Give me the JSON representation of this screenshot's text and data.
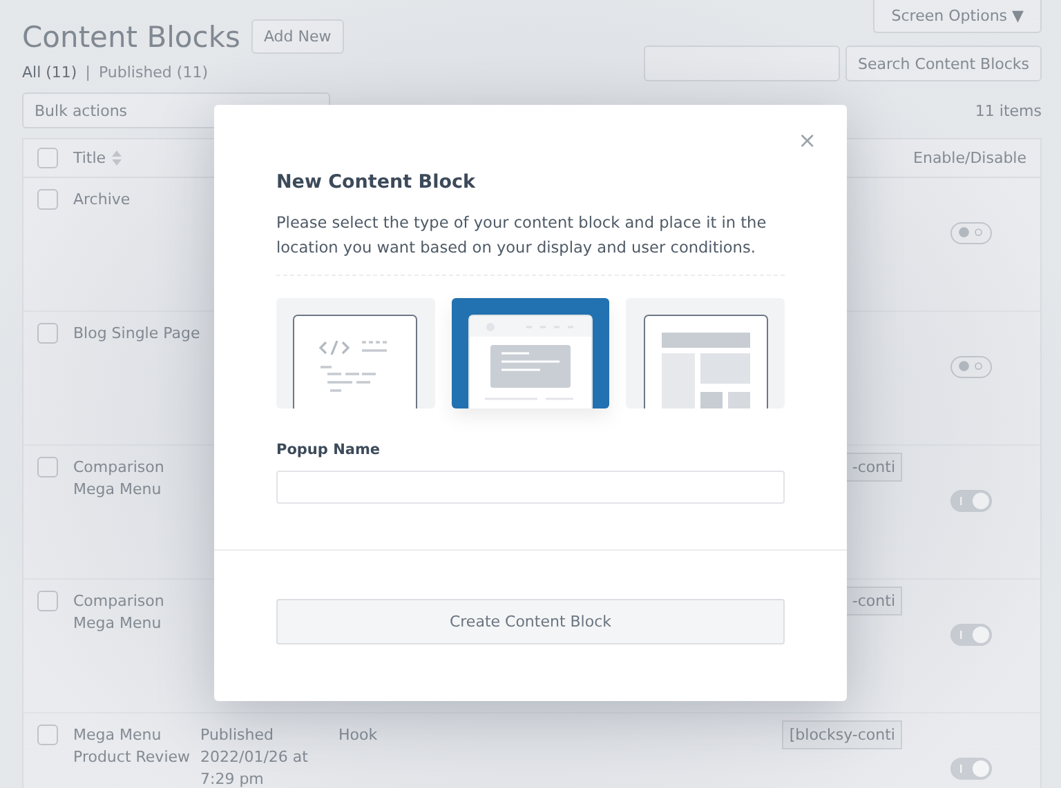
{
  "page": {
    "title": "Content Blocks",
    "add_new": "Add New",
    "screen_options": "Screen Options ▼",
    "filters": [
      {
        "label": "All",
        "count": "(11)",
        "selected": true
      },
      {
        "label": "Published",
        "count": "(11)",
        "selected": false
      }
    ],
    "filter_separator": "|",
    "search_button": "Search Content Blocks",
    "bulk_actions": "Bulk actions",
    "items_count": "11 items"
  },
  "table": {
    "columns": {
      "title": "Title",
      "enable": "Enable/Disable"
    },
    "select_all_checked": false,
    "rows": [
      {
        "title": "Archive",
        "checked": false,
        "on": false
      },
      {
        "title": "Blog Single Page",
        "checked": false,
        "on": false
      },
      {
        "title": "Comparison Mega Menu",
        "checked": false,
        "shortcode": "-conti",
        "on": true
      },
      {
        "title": "Comparison Mega Menu",
        "checked": false,
        "shortcode": "-conti",
        "on": true
      },
      {
        "title": "Mega Menu Product Review",
        "checked": false,
        "status": "Published",
        "date": "2022/01/26 at 7:29 pm",
        "type": "Hook",
        "shortcode": "[blocksy-conti",
        "on": true
      }
    ]
  },
  "modal": {
    "close": "×",
    "title": "New Content Block",
    "description": "Please select the type of your content block and place it in the location you want based on your display and user conditions.",
    "templates": [
      {
        "kind": "code",
        "selected": false
      },
      {
        "kind": "popup",
        "selected": true
      },
      {
        "kind": "layout",
        "selected": false
      }
    ],
    "name_label": "Popup Name",
    "submit": "Create Content Block"
  }
}
